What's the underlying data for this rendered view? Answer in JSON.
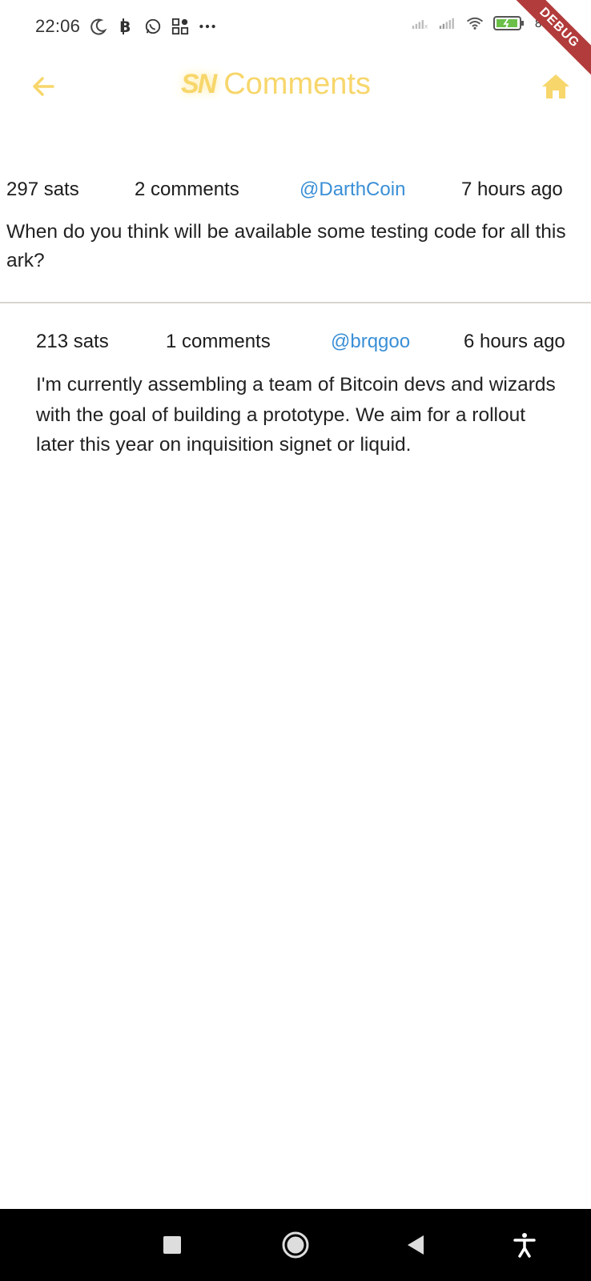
{
  "status_bar": {
    "time": "22:06",
    "battery_percent": "88%"
  },
  "app_bar": {
    "logo": "SN",
    "title": "Comments",
    "accent_color": "#f7d66b"
  },
  "debug_banner": "DEBUG",
  "post": {
    "sats": "297 sats",
    "comments": "2 comments",
    "user": "@DarthCoin",
    "time": "7 hours ago",
    "text": "When do you think will be available some testing code for all this ark?"
  },
  "comment": {
    "sats": "213 sats",
    "comments": "1 comments",
    "user": "@brqgoo",
    "time": "6 hours ago",
    "text": "I'm currently assembling a team of Bitcoin devs and wizards with the goal of building a prototype. We aim for a rollout later this year on inquisition signet or liquid."
  },
  "icons": {
    "back": "arrow-left-icon",
    "home": "home-icon",
    "nav_recent": "square-icon",
    "nav_home": "circle-icon",
    "nav_back": "triangle-back-icon",
    "nav_accessibility": "accessibility-icon"
  },
  "colors": {
    "link": "#3a8fd6",
    "debug": "#b23b3b"
  }
}
